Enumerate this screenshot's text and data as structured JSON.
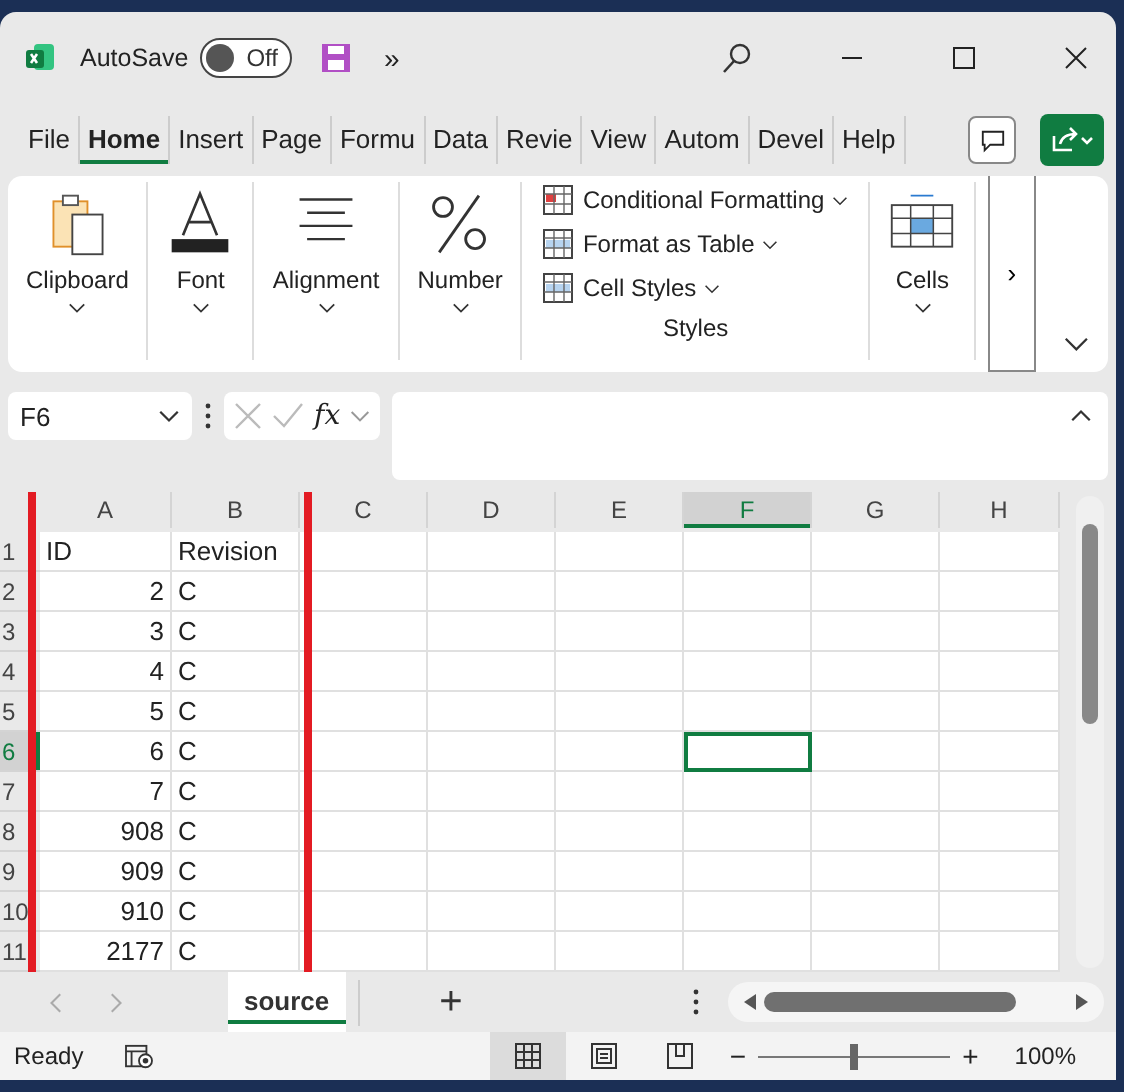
{
  "titlebar": {
    "autosave_label": "AutoSave",
    "autosave_toggle": {
      "label": "Off",
      "on": false
    },
    "overflow": "»"
  },
  "menu_tabs": [
    {
      "label": "File",
      "selected": false
    },
    {
      "label": "Home",
      "selected": true
    },
    {
      "label": "Insert",
      "selected": false
    },
    {
      "label": "Page",
      "selected": false
    },
    {
      "label": "Formu",
      "selected": false
    },
    {
      "label": "Data",
      "selected": false
    },
    {
      "label": "Revie",
      "selected": false
    },
    {
      "label": "View",
      "selected": false
    },
    {
      "label": "Autom",
      "selected": false
    },
    {
      "label": "Devel",
      "selected": false
    },
    {
      "label": "Help",
      "selected": false
    }
  ],
  "ribbon": {
    "groups": [
      {
        "label": "Clipboard",
        "kind": "clipboard"
      },
      {
        "label": "Font",
        "kind": "font"
      },
      {
        "label": "Alignment",
        "kind": "alignment"
      },
      {
        "label": "Number",
        "kind": "number"
      }
    ],
    "styles": {
      "label": "Styles",
      "items": [
        "Conditional Formatting",
        "Format as Table",
        "Cell Styles"
      ]
    },
    "cells": {
      "label": "Cells"
    },
    "more": "›"
  },
  "formula_bar": {
    "name_box": "F6",
    "fx": "fx"
  },
  "grid": {
    "columns": [
      {
        "label": "A",
        "selected": false
      },
      {
        "label": "B",
        "selected": false
      },
      {
        "label": "C",
        "selected": false
      },
      {
        "label": "D",
        "selected": false
      },
      {
        "label": "E",
        "selected": false
      },
      {
        "label": "F",
        "selected": true
      },
      {
        "label": "G",
        "selected": false
      },
      {
        "label": "H",
        "selected": false
      }
    ],
    "rows": [
      {
        "header": "1",
        "selected": false,
        "a": {
          "value": "ID",
          "kind": "text"
        },
        "b": "Revision"
      },
      {
        "header": "2",
        "selected": false,
        "a": {
          "value": "2",
          "kind": "number"
        },
        "b": "C"
      },
      {
        "header": "3",
        "selected": false,
        "a": {
          "value": "3",
          "kind": "number"
        },
        "b": "C"
      },
      {
        "header": "4",
        "selected": false,
        "a": {
          "value": "4",
          "kind": "number"
        },
        "b": "C"
      },
      {
        "header": "5",
        "selected": false,
        "a": {
          "value": "5",
          "kind": "number"
        },
        "b": "C"
      },
      {
        "header": "6",
        "selected": true,
        "a": {
          "value": "6",
          "kind": "number"
        },
        "b": "C"
      },
      {
        "header": "7",
        "selected": false,
        "a": {
          "value": "7",
          "kind": "number"
        },
        "b": "C"
      },
      {
        "header": "8",
        "selected": false,
        "a": {
          "value": "908",
          "kind": "number"
        },
        "b": "C"
      },
      {
        "header": "9",
        "selected": false,
        "a": {
          "value": "909",
          "kind": "number"
        },
        "b": "C"
      },
      {
        "header": "10",
        "selected": false,
        "a": {
          "value": "910",
          "kind": "number"
        },
        "b": "C"
      },
      {
        "header": "11",
        "selected": false,
        "a": {
          "value": "2177",
          "kind": "number"
        },
        "b": "C"
      }
    ]
  },
  "sheet_tabs": [
    {
      "label": "source",
      "selected": true
    }
  ],
  "add_sheet": "+",
  "status_bar": {
    "status": "Ready",
    "views": [
      {
        "kind": "normal",
        "selected": true
      },
      {
        "kind": "page_layout",
        "selected": false
      },
      {
        "kind": "page_break",
        "selected": false
      }
    ],
    "zoom": {
      "minus": "−",
      "plus": "+",
      "level": 0.5,
      "reading": "100%"
    }
  }
}
